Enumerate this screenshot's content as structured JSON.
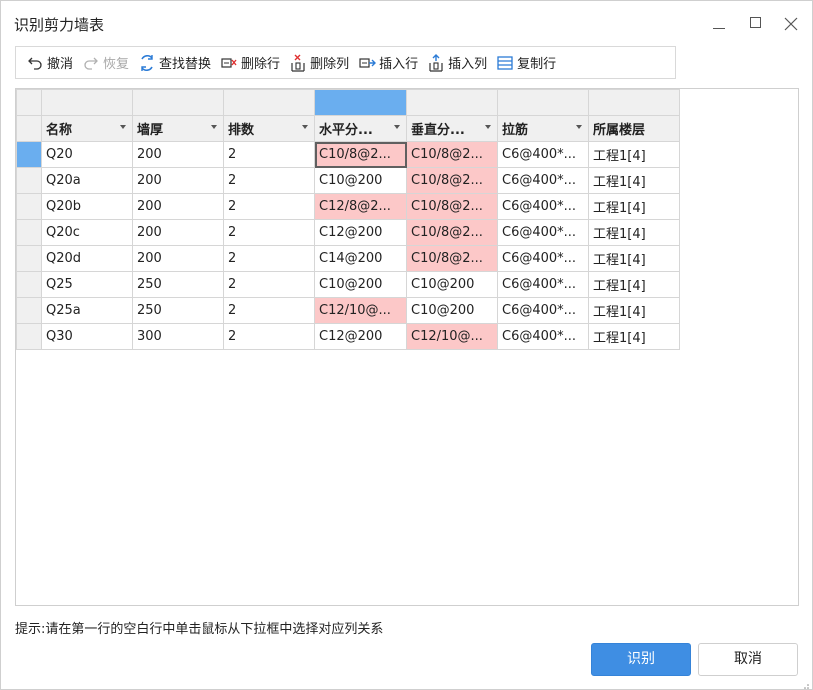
{
  "window": {
    "title": "识别剪力墙表",
    "minimize_icon": "minimize-icon",
    "maximize_icon": "maximize-icon",
    "close_icon": "close-icon"
  },
  "toolbar": {
    "items": [
      {
        "label": "撤消",
        "icon": "undo-icon",
        "enabled": true
      },
      {
        "label": "恢复",
        "icon": "redo-icon",
        "enabled": false
      },
      {
        "label": "查找替换",
        "icon": "find-replace-icon",
        "enabled": true
      },
      {
        "label": "删除行",
        "icon": "delete-row-icon",
        "enabled": true
      },
      {
        "label": "删除列",
        "icon": "delete-column-icon",
        "enabled": true
      },
      {
        "label": "插入行",
        "icon": "insert-row-icon",
        "enabled": true
      },
      {
        "label": "插入列",
        "icon": "insert-column-icon",
        "enabled": true
      },
      {
        "label": "复制行",
        "icon": "copy-row-icon",
        "enabled": true
      }
    ]
  },
  "table": {
    "selected_column_index": 3,
    "active_row_index": 0,
    "columns": [
      "名称",
      "墙厚",
      "排数",
      "水平分...",
      "垂直分...",
      "拉筋",
      "所属楼层"
    ],
    "rows": [
      [
        "Q20",
        "200",
        "2",
        "C10/8@2...",
        "C10/8@2...",
        "C6@400*...",
        "工程1[4]"
      ],
      [
        "Q20a",
        "200",
        "2",
        "C10@200",
        "C10/8@2...",
        "C6@400*...",
        "工程1[4]"
      ],
      [
        "Q20b",
        "200",
        "2",
        "C12/8@2...",
        "C10/8@2...",
        "C6@400*...",
        "工程1[4]"
      ],
      [
        "Q20c",
        "200",
        "2",
        "C12@200",
        "C10/8@2...",
        "C6@400*...",
        "工程1[4]"
      ],
      [
        "Q20d",
        "200",
        "2",
        "C14@200",
        "C10/8@2...",
        "C6@400*...",
        "工程1[4]"
      ],
      [
        "Q25",
        "250",
        "2",
        "C10@200",
        "C10@200",
        "C6@400*...",
        "工程1[4]"
      ],
      [
        "Q25a",
        "250",
        "2",
        "C12/10@...",
        "C10@200",
        "C6@400*...",
        "工程1[4]"
      ],
      [
        "Q30",
        "300",
        "2",
        "C12@200",
        "C12/10@...",
        "C6@400*...",
        "工程1[4]"
      ]
    ],
    "highlight_color": "#fcc8c8",
    "selection_color": "#6aaeef"
  },
  "hint": "提示:请在第一行的空白行中单击鼠标从下拉框中选择对应列关系",
  "buttons": {
    "ok": "识别",
    "cancel": "取消",
    "primary_color": "#3f8ee3"
  }
}
